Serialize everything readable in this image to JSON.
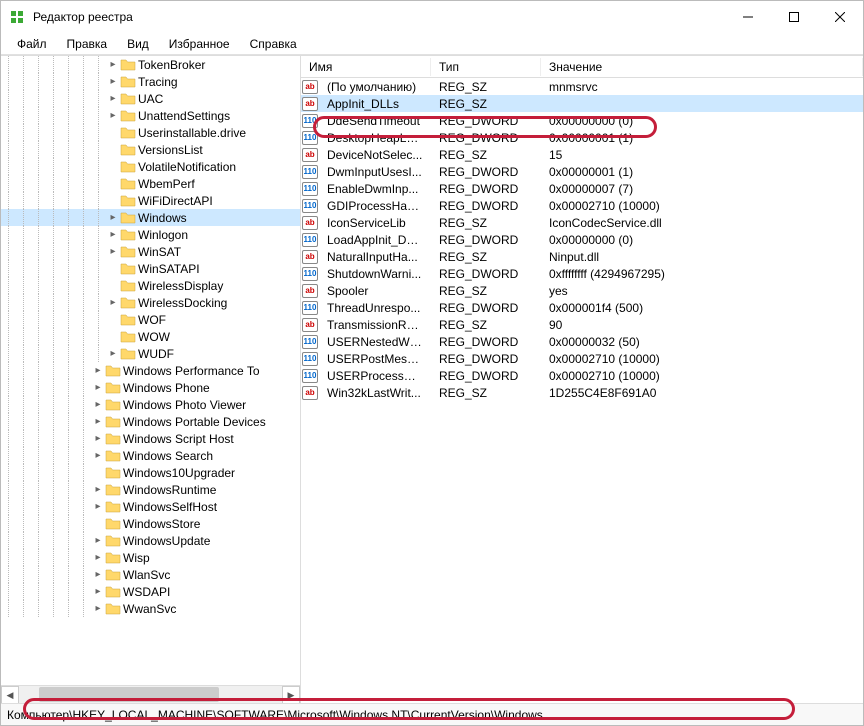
{
  "window": {
    "title": "Редактор реестра"
  },
  "menu": [
    "Файл",
    "Правка",
    "Вид",
    "Избранное",
    "Справка"
  ],
  "columns": {
    "name": "Имя",
    "type": "Тип",
    "value": "Значение"
  },
  "tree": {
    "items": [
      {
        "level": 7,
        "label": "TokenBroker",
        "exp": "+"
      },
      {
        "level": 7,
        "label": "Tracing",
        "exp": "+"
      },
      {
        "level": 7,
        "label": "UAC",
        "exp": "+"
      },
      {
        "level": 7,
        "label": "UnattendSettings",
        "exp": "+"
      },
      {
        "level": 7,
        "label": "Userinstallable.drive",
        "exp": ""
      },
      {
        "level": 7,
        "label": "VersionsList",
        "exp": ""
      },
      {
        "level": 7,
        "label": "VolatileNotification",
        "exp": ""
      },
      {
        "level": 7,
        "label": "WbemPerf",
        "exp": ""
      },
      {
        "level": 7,
        "label": "WiFiDirectAPI",
        "exp": ""
      },
      {
        "level": 7,
        "label": "Windows",
        "exp": "+",
        "selected": true
      },
      {
        "level": 7,
        "label": "Winlogon",
        "exp": "+"
      },
      {
        "level": 7,
        "label": "WinSAT",
        "exp": "+"
      },
      {
        "level": 7,
        "label": "WinSATAPI",
        "exp": ""
      },
      {
        "level": 7,
        "label": "WirelessDisplay",
        "exp": ""
      },
      {
        "level": 7,
        "label": "WirelessDocking",
        "exp": "+"
      },
      {
        "level": 7,
        "label": "WOF",
        "exp": ""
      },
      {
        "level": 7,
        "label": "WOW",
        "exp": ""
      },
      {
        "level": 7,
        "label": "WUDF",
        "exp": "+"
      },
      {
        "level": 6,
        "label": "Windows Performance To",
        "exp": "+"
      },
      {
        "level": 6,
        "label": "Windows Phone",
        "exp": "+"
      },
      {
        "level": 6,
        "label": "Windows Photo Viewer",
        "exp": "+"
      },
      {
        "level": 6,
        "label": "Windows Portable Devices",
        "exp": "+"
      },
      {
        "level": 6,
        "label": "Windows Script Host",
        "exp": "+"
      },
      {
        "level": 6,
        "label": "Windows Search",
        "exp": "+"
      },
      {
        "level": 6,
        "label": "Windows10Upgrader",
        "exp": ""
      },
      {
        "level": 6,
        "label": "WindowsRuntime",
        "exp": "+"
      },
      {
        "level": 6,
        "label": "WindowsSelfHost",
        "exp": "+"
      },
      {
        "level": 6,
        "label": "WindowsStore",
        "exp": ""
      },
      {
        "level": 6,
        "label": "WindowsUpdate",
        "exp": "+"
      },
      {
        "level": 6,
        "label": "Wisp",
        "exp": "+"
      },
      {
        "level": 6,
        "label": "WlanSvc",
        "exp": "+"
      },
      {
        "level": 6,
        "label": "WSDAPI",
        "exp": "+"
      },
      {
        "level": 6,
        "label": "WwanSvc",
        "exp": "+"
      }
    ]
  },
  "values": [
    {
      "name": "(По умолчанию)",
      "type": "REG_SZ",
      "value": "mnmsrvc",
      "icon": "sz"
    },
    {
      "name": "AppInit_DLLs",
      "type": "REG_SZ",
      "value": "",
      "icon": "sz",
      "selected": true
    },
    {
      "name": "DdeSendTimeout",
      "type": "REG_DWORD",
      "value": "0x00000000 (0)",
      "icon": "dw"
    },
    {
      "name": "DesktopHeapLo...",
      "type": "REG_DWORD",
      "value": "0x00000001 (1)",
      "icon": "dw"
    },
    {
      "name": "DeviceNotSelec...",
      "type": "REG_SZ",
      "value": "15",
      "icon": "sz"
    },
    {
      "name": "DwmInputUsesI...",
      "type": "REG_DWORD",
      "value": "0x00000001 (1)",
      "icon": "dw"
    },
    {
      "name": "EnableDwmInp...",
      "type": "REG_DWORD",
      "value": "0x00000007 (7)",
      "icon": "dw"
    },
    {
      "name": "GDIProcessHan...",
      "type": "REG_DWORD",
      "value": "0x00002710 (10000)",
      "icon": "dw"
    },
    {
      "name": "IconServiceLib",
      "type": "REG_SZ",
      "value": "IconCodecService.dll",
      "icon": "sz"
    },
    {
      "name": "LoadAppInit_DL...",
      "type": "REG_DWORD",
      "value": "0x00000000 (0)",
      "icon": "dw"
    },
    {
      "name": "NaturalInputHa...",
      "type": "REG_SZ",
      "value": "Ninput.dll",
      "icon": "sz"
    },
    {
      "name": "ShutdownWarni...",
      "type": "REG_DWORD",
      "value": "0xffffffff (4294967295)",
      "icon": "dw"
    },
    {
      "name": "Spooler",
      "type": "REG_SZ",
      "value": "yes",
      "icon": "sz"
    },
    {
      "name": "ThreadUnrespo...",
      "type": "REG_DWORD",
      "value": "0x000001f4 (500)",
      "icon": "dw"
    },
    {
      "name": "TransmissionRe...",
      "type": "REG_SZ",
      "value": "90",
      "icon": "sz"
    },
    {
      "name": "USERNestedWin...",
      "type": "REG_DWORD",
      "value": "0x00000032 (50)",
      "icon": "dw"
    },
    {
      "name": "USERPostMessa...",
      "type": "REG_DWORD",
      "value": "0x00002710 (10000)",
      "icon": "dw"
    },
    {
      "name": "USERProcessHa...",
      "type": "REG_DWORD",
      "value": "0x00002710 (10000)",
      "icon": "dw"
    },
    {
      "name": "Win32kLastWrit...",
      "type": "REG_SZ",
      "value": "1D255C4E8F691A0",
      "icon": "sz"
    }
  ],
  "statusbar": {
    "path": "Компьютер\\HKEY_LOCAL_MACHINE\\SOFTWARE\\Microsoft\\Windows NT\\CurrentVersion\\Windows"
  },
  "icon_text": {
    "sz": "ab",
    "dw": "110"
  }
}
